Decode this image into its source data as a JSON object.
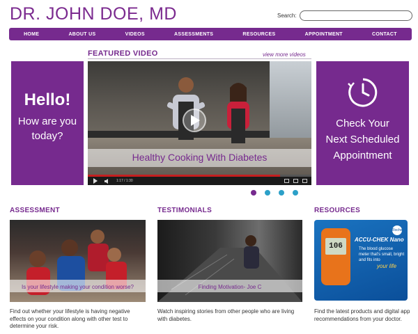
{
  "header": {
    "site_title": "DR. JOHN DOE, MD",
    "search_label": "Search:",
    "search_value": ""
  },
  "nav": {
    "items": [
      "HOME",
      "ABOUT US",
      "VIDEOS",
      "ASSESSMENTS",
      "RESOURCES",
      "APPOINTMENT",
      "CONTACT"
    ]
  },
  "hello_panel": {
    "headline": "Hello!",
    "line1": "How are you",
    "line2": "today?"
  },
  "featured": {
    "title": "FEATURED VIDEO",
    "view_more": "view more videos",
    "caption": "Healthy Cooking With Diabetes",
    "time": "1:17 / 1:30",
    "progress": 0.86
  },
  "appointment_panel": {
    "line1": "Check Your",
    "line2": "Next Scheduled",
    "line3": "Appointment",
    "icon": "clock-icon"
  },
  "carousel": {
    "count": 4,
    "active_index": 0
  },
  "sections": {
    "assessment": {
      "title": "ASSESSMENT",
      "caption": "Is your lifestyle making your condition worse?",
      "description": "Find out whether your lifestyle is having negative effects on your condition along with other test to determine your risk."
    },
    "testimonials": {
      "title": "TESTIMONIALS",
      "caption": "Finding Motivation- Joe C",
      "description": "Watch inspiring stories from other people who are living with diabetes."
    },
    "resources": {
      "title": "RESOURCES",
      "description": "Find the latest products and digital app recommendations from your doctor.",
      "product_brand": "ACCU-CHEK Nano",
      "product_text": "The blood glucose meter that's small, bright and fits into",
      "product_tagline": "your life",
      "meter_reading": "106",
      "logo_text": "Roche"
    }
  },
  "colors": {
    "brand_purple": "#762a8e",
    "dot_blue": "#2ca0c8",
    "progress_red": "#c41f1f"
  }
}
